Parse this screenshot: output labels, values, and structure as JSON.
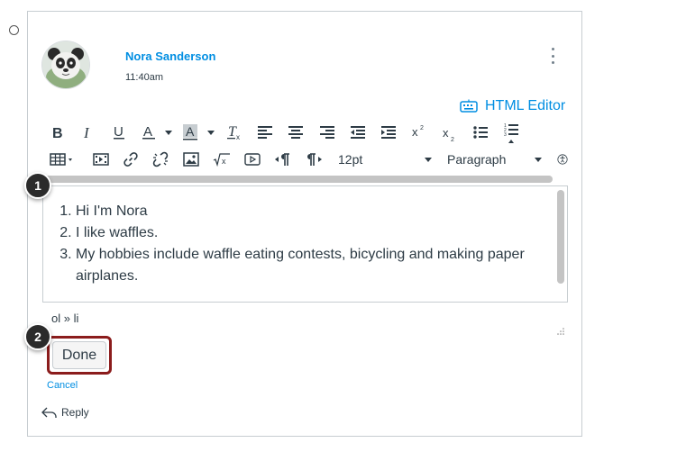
{
  "post": {
    "author": "Nora Sanderson",
    "time": "11:40am"
  },
  "editor_header": {
    "html_editor_label": "HTML Editor"
  },
  "toolbar": {
    "font_size": "12pt",
    "block_format": "Paragraph"
  },
  "content": {
    "list_items": [
      "Hi I'm Nora",
      "I like waffles.",
      "My hobbies include waffle eating contests, bicycling and making paper airplanes."
    ]
  },
  "status": {
    "element_path": "ol » li"
  },
  "actions": {
    "done_label": "Done",
    "cancel_label": "Cancel",
    "reply_label": "Reply"
  },
  "callouts": [
    "1",
    "2"
  ],
  "colors": {
    "link": "#008ee2",
    "text": "#2d3b45",
    "done_highlight": "#8b1c1c",
    "callout_bg": "#2b2b2b"
  }
}
